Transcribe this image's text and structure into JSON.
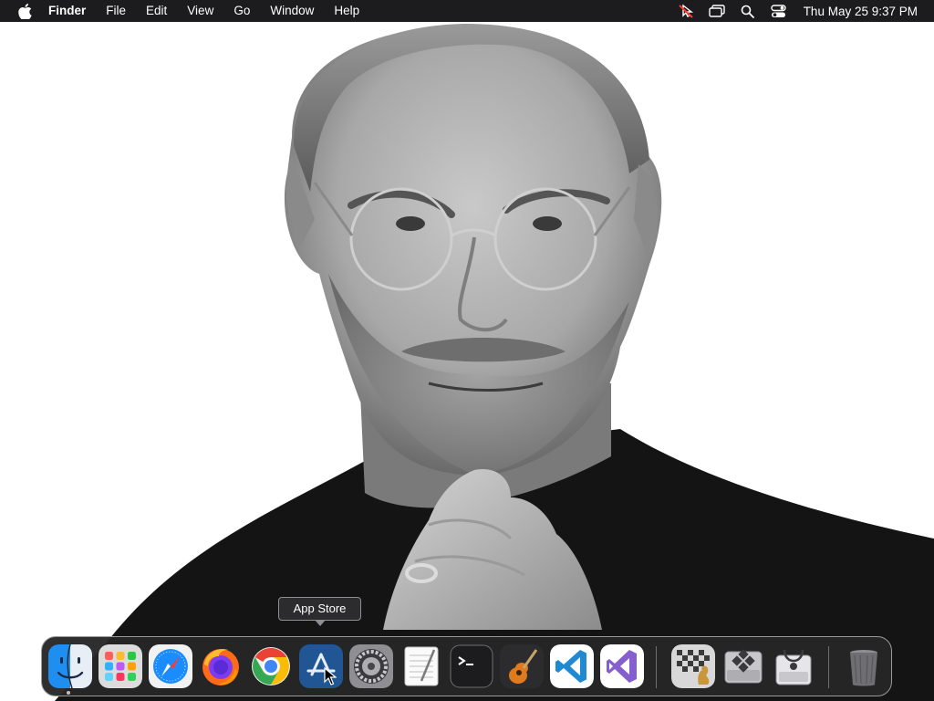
{
  "menubar": {
    "app_name": "Finder",
    "items": [
      "File",
      "Edit",
      "View",
      "Go",
      "Window",
      "Help"
    ],
    "clock": "Thu May 25  9:37 PM",
    "status_icons": [
      "pointer-off-icon",
      "screens-icon",
      "search-icon",
      "control-center-icon"
    ]
  },
  "tooltip": {
    "text": "App Store"
  },
  "dock": {
    "apps": [
      {
        "name": "Finder",
        "icon": "finder-icon",
        "running": true
      },
      {
        "name": "Launchpad",
        "icon": "launchpad-icon"
      },
      {
        "name": "Safari",
        "icon": "safari-icon"
      },
      {
        "name": "Firefox",
        "icon": "firefox-icon"
      },
      {
        "name": "Google Chrome",
        "icon": "chrome-icon"
      },
      {
        "name": "App Store",
        "icon": "app-store-icon",
        "hovered": true
      },
      {
        "name": "System Preferences",
        "icon": "system-preferences-icon"
      },
      {
        "name": "TextEdit",
        "icon": "textedit-icon"
      },
      {
        "name": "Terminal",
        "icon": "terminal-icon"
      },
      {
        "name": "GarageBand",
        "icon": "garageband-icon"
      },
      {
        "name": "Visual Studio Code",
        "icon": "vscode-icon"
      },
      {
        "name": "Visual Studio",
        "icon": "visual-studio-icon"
      },
      {
        "name": "Chess",
        "icon": "chess-icon"
      },
      {
        "name": "Boot Camp Assistant",
        "icon": "boot-camp-icon"
      },
      {
        "name": "Disk Utility",
        "icon": "disk-utility-icon"
      },
      {
        "name": "Trash",
        "icon": "trash-icon"
      }
    ]
  },
  "colors": {
    "menubar_bg": "#1c1c1e",
    "dock_bg": "#262628",
    "tooltip_bg": "#2c2c2e"
  }
}
